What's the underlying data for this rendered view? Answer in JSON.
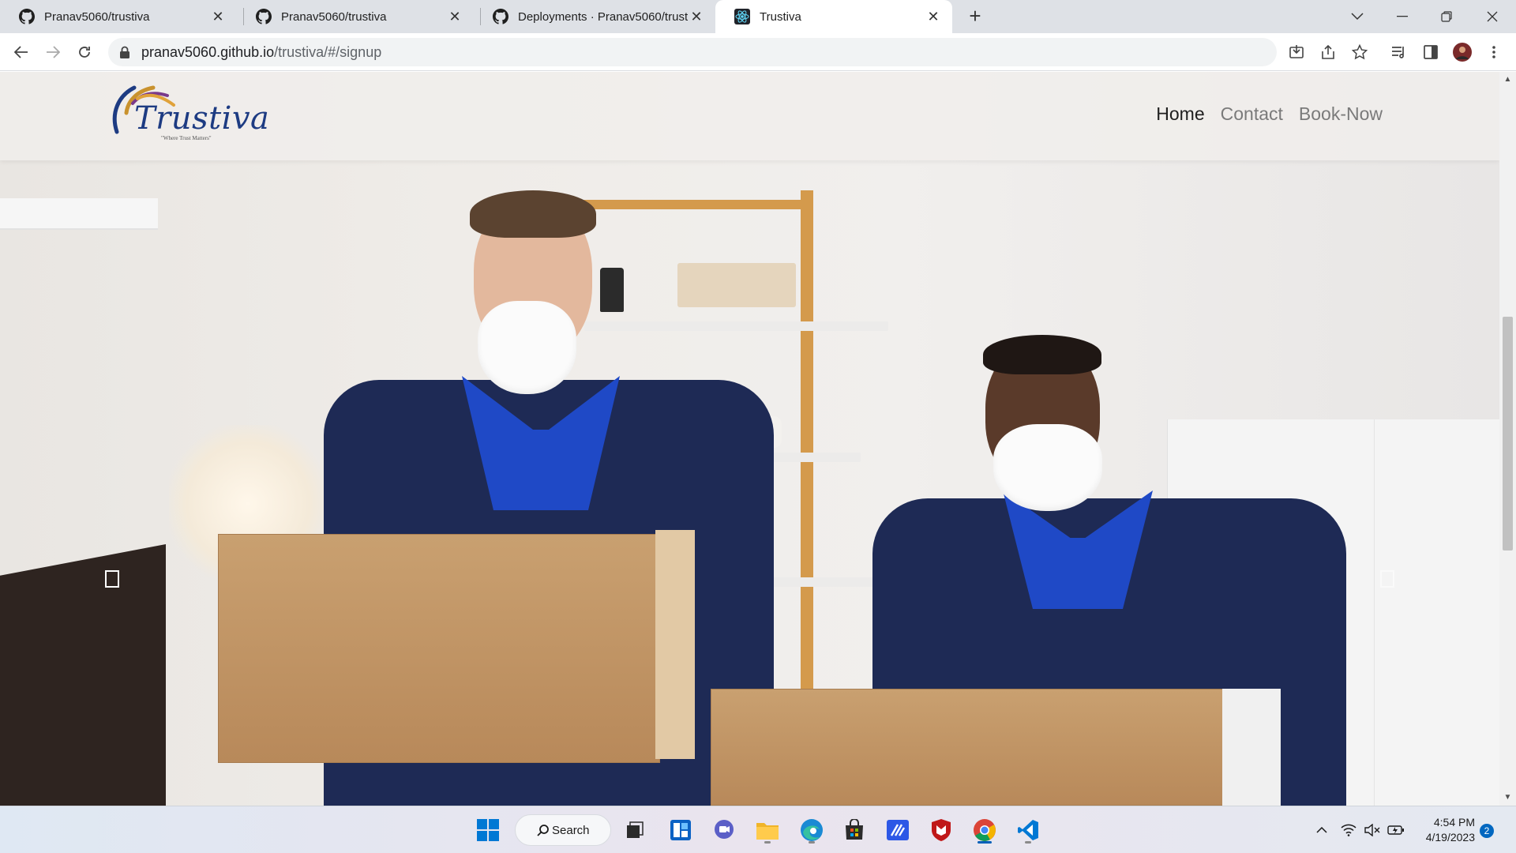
{
  "browser": {
    "tabs": [
      {
        "title": "Pranav5060/trustiva",
        "favicon": "github-icon"
      },
      {
        "title": "Pranav5060/trustiva",
        "favicon": "github-icon"
      },
      {
        "title": "Deployments · Pranav5060/trusti",
        "favicon": "github-icon"
      },
      {
        "title": "Trustiva",
        "favicon": "react-icon",
        "active": true
      }
    ],
    "url_host": "pranav5060.github.io",
    "url_path": "/trustiva/#/signup"
  },
  "site": {
    "brand": "Trustiva",
    "tagline": "\"Where Trust Matters\"",
    "nav": {
      "home": "Home",
      "contact": "Contact",
      "book_now": "Book-Now"
    }
  },
  "taskbar": {
    "search_label": "Search",
    "time": "4:54 PM",
    "date": "4/19/2023",
    "notification_count": "2"
  }
}
